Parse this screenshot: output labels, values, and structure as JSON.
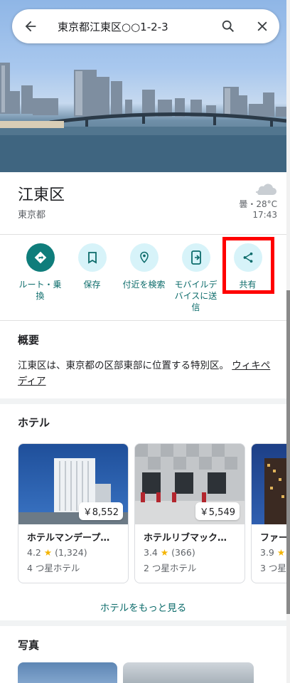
{
  "search": {
    "query": "東京都江東区○○1-2-3",
    "back_icon": "arrow-back-icon",
    "search_icon": "search-icon",
    "close_icon": "close-icon"
  },
  "place": {
    "title": "江東区",
    "subtitle": "東京都"
  },
  "weather": {
    "condition_temp": "曇・28°C",
    "time": "17:43",
    "icon": "cloud-icon"
  },
  "actions": [
    {
      "label": "ルート・乗換",
      "icon": "directions-icon"
    },
    {
      "label": "保存",
      "icon": "bookmark-icon"
    },
    {
      "label": "付近を検索",
      "icon": "nearby-icon"
    },
    {
      "label": "モバイルデバイスに送信",
      "icon": "send-to-phone-icon"
    },
    {
      "label": "共有",
      "icon": "share-icon"
    }
  ],
  "overview": {
    "title": "概要",
    "text": "江東区は、東京都の区部東部に位置する特別区。",
    "link": "ウィキペディア"
  },
  "hotels": {
    "title": "ホテル",
    "items": [
      {
        "price": "￥8,552",
        "name": "ホテルマンデープ…",
        "rating": "4.2",
        "reviews": "(1,324)",
        "class": "4 つ星ホテル"
      },
      {
        "price": "￥5,549",
        "name": "ホテルリブマック…",
        "rating": "3.4",
        "reviews": "(366)",
        "class": "2 つ星ホテル"
      },
      {
        "price": "",
        "name": "ファー…",
        "rating": "3.9",
        "reviews": "",
        "class": "3 つ星"
      }
    ],
    "more": "ホテルをもっと見る"
  },
  "photos": {
    "title": "写真"
  },
  "colors": {
    "accent": "#0f7d7b",
    "accent_text": "#0b6b6a",
    "chip_bg": "#d7f3f9",
    "highlight": "#ff0000",
    "star": "#f4b400"
  }
}
